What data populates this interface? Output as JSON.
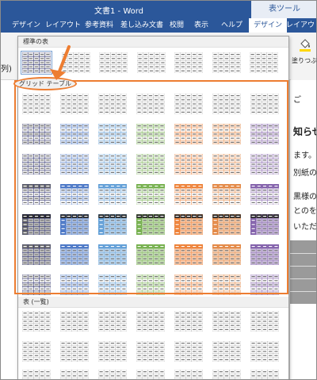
{
  "window": {
    "title": "文書1 - Word",
    "context_tab_group": "表ツール"
  },
  "tabs": [
    {
      "label": "デザイン"
    },
    {
      "label": "レイアウト"
    },
    {
      "label": "参考資料"
    },
    {
      "label": "差し込み文書"
    },
    {
      "label": "校閲"
    },
    {
      "label": "表示"
    },
    {
      "label": "ヘルプ"
    },
    {
      "label": "デザイン",
      "active": true
    },
    {
      "label": "レイアウト"
    }
  ],
  "ribbon": {
    "left_partial_label": "列)",
    "shading_button_label": "塗りつぶし"
  },
  "gallery": {
    "sections": [
      {
        "title": "標準の表"
      },
      {
        "title": "グリッド テーブル"
      },
      {
        "title": "表 (一覧)"
      }
    ],
    "grid_colors": [
      "#6b6b6b",
      "#4472c4",
      "#5b9bd5",
      "#70ad47",
      "#ed7d31",
      "#e2843f",
      "#7e5ba8"
    ]
  },
  "document": {
    "lines": [
      "ご",
      "知らせ",
      "ます。",
      "別紙の",
      "黒様の",
      "とのを、",
      "いただき"
    ]
  },
  "highlight_color": "#ed7d31"
}
